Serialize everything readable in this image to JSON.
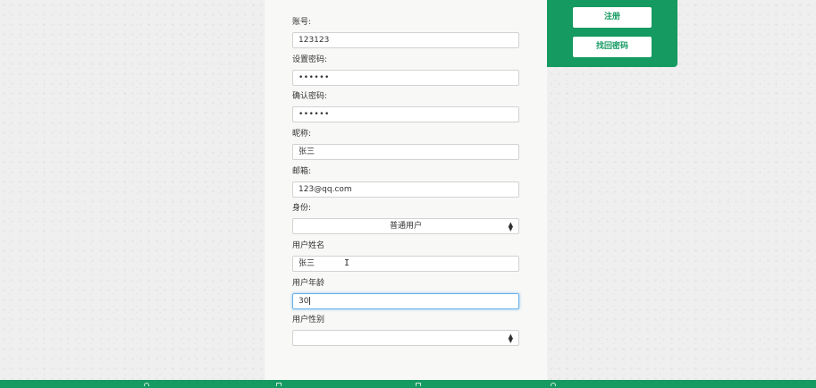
{
  "form": {
    "account_label": "账号:",
    "account_value": "123123",
    "password_label": "设置密码:",
    "password_value": "••••••",
    "confirm_label": "确认密码:",
    "confirm_value": "••••••",
    "nickname_label": "昵称:",
    "nickname_value": "张三",
    "email_label": "邮箱:",
    "email_value": "123@qq.com",
    "role_label": "身份:",
    "role_value": "普通用户",
    "username_label": "用户姓名",
    "username_value": "张三",
    "age_label": "用户年龄",
    "age_value": "30",
    "gender_label": "用户性别",
    "gender_value": ""
  },
  "side": {
    "register_label": "注册",
    "recover_label": "找回密码"
  },
  "icons": {
    "select_arrow": "select-arrow-icon",
    "text_cursor": "text-cursor-icon",
    "footer": [
      "user-icon",
      "document-icon",
      "document-icon",
      "location-icon"
    ]
  },
  "colors": {
    "brand_green": "#159a62",
    "focus_blue": "#66afe9"
  }
}
